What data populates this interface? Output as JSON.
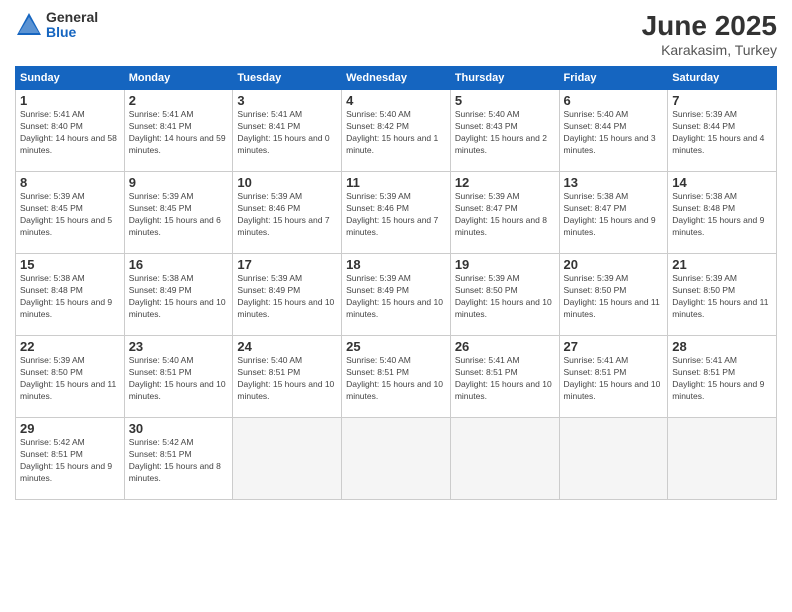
{
  "logo": {
    "general": "General",
    "blue": "Blue"
  },
  "title": "June 2025",
  "location": "Karakasim, Turkey",
  "days_header": [
    "Sunday",
    "Monday",
    "Tuesday",
    "Wednesday",
    "Thursday",
    "Friday",
    "Saturday"
  ],
  "weeks": [
    [
      {
        "day": 1,
        "sunrise": "5:41 AM",
        "sunset": "8:40 PM",
        "daylight": "14 hours and 58 minutes."
      },
      {
        "day": 2,
        "sunrise": "5:41 AM",
        "sunset": "8:41 PM",
        "daylight": "14 hours and 59 minutes."
      },
      {
        "day": 3,
        "sunrise": "5:41 AM",
        "sunset": "8:41 PM",
        "daylight": "15 hours and 0 minutes."
      },
      {
        "day": 4,
        "sunrise": "5:40 AM",
        "sunset": "8:42 PM",
        "daylight": "15 hours and 1 minute."
      },
      {
        "day": 5,
        "sunrise": "5:40 AM",
        "sunset": "8:43 PM",
        "daylight": "15 hours and 2 minutes."
      },
      {
        "day": 6,
        "sunrise": "5:40 AM",
        "sunset": "8:44 PM",
        "daylight": "15 hours and 3 minutes."
      },
      {
        "day": 7,
        "sunrise": "5:39 AM",
        "sunset": "8:44 PM",
        "daylight": "15 hours and 4 minutes."
      }
    ],
    [
      {
        "day": 8,
        "sunrise": "5:39 AM",
        "sunset": "8:45 PM",
        "daylight": "15 hours and 5 minutes."
      },
      {
        "day": 9,
        "sunrise": "5:39 AM",
        "sunset": "8:45 PM",
        "daylight": "15 hours and 6 minutes."
      },
      {
        "day": 10,
        "sunrise": "5:39 AM",
        "sunset": "8:46 PM",
        "daylight": "15 hours and 7 minutes."
      },
      {
        "day": 11,
        "sunrise": "5:39 AM",
        "sunset": "8:46 PM",
        "daylight": "15 hours and 7 minutes."
      },
      {
        "day": 12,
        "sunrise": "5:39 AM",
        "sunset": "8:47 PM",
        "daylight": "15 hours and 8 minutes."
      },
      {
        "day": 13,
        "sunrise": "5:38 AM",
        "sunset": "8:47 PM",
        "daylight": "15 hours and 9 minutes."
      },
      {
        "day": 14,
        "sunrise": "5:38 AM",
        "sunset": "8:48 PM",
        "daylight": "15 hours and 9 minutes."
      }
    ],
    [
      {
        "day": 15,
        "sunrise": "5:38 AM",
        "sunset": "8:48 PM",
        "daylight": "15 hours and 9 minutes."
      },
      {
        "day": 16,
        "sunrise": "5:38 AM",
        "sunset": "8:49 PM",
        "daylight": "15 hours and 10 minutes."
      },
      {
        "day": 17,
        "sunrise": "5:39 AM",
        "sunset": "8:49 PM",
        "daylight": "15 hours and 10 minutes."
      },
      {
        "day": 18,
        "sunrise": "5:39 AM",
        "sunset": "8:49 PM",
        "daylight": "15 hours and 10 minutes."
      },
      {
        "day": 19,
        "sunrise": "5:39 AM",
        "sunset": "8:50 PM",
        "daylight": "15 hours and 10 minutes."
      },
      {
        "day": 20,
        "sunrise": "5:39 AM",
        "sunset": "8:50 PM",
        "daylight": "15 hours and 11 minutes."
      },
      {
        "day": 21,
        "sunrise": "5:39 AM",
        "sunset": "8:50 PM",
        "daylight": "15 hours and 11 minutes."
      }
    ],
    [
      {
        "day": 22,
        "sunrise": "5:39 AM",
        "sunset": "8:50 PM",
        "daylight": "15 hours and 11 minutes."
      },
      {
        "day": 23,
        "sunrise": "5:40 AM",
        "sunset": "8:51 PM",
        "daylight": "15 hours and 10 minutes."
      },
      {
        "day": 24,
        "sunrise": "5:40 AM",
        "sunset": "8:51 PM",
        "daylight": "15 hours and 10 minutes."
      },
      {
        "day": 25,
        "sunrise": "5:40 AM",
        "sunset": "8:51 PM",
        "daylight": "15 hours and 10 minutes."
      },
      {
        "day": 26,
        "sunrise": "5:41 AM",
        "sunset": "8:51 PM",
        "daylight": "15 hours and 10 minutes."
      },
      {
        "day": 27,
        "sunrise": "5:41 AM",
        "sunset": "8:51 PM",
        "daylight": "15 hours and 10 minutes."
      },
      {
        "day": 28,
        "sunrise": "5:41 AM",
        "sunset": "8:51 PM",
        "daylight": "15 hours and 9 minutes."
      }
    ],
    [
      {
        "day": 29,
        "sunrise": "5:42 AM",
        "sunset": "8:51 PM",
        "daylight": "15 hours and 9 minutes."
      },
      {
        "day": 30,
        "sunrise": "5:42 AM",
        "sunset": "8:51 PM",
        "daylight": "15 hours and 8 minutes."
      },
      null,
      null,
      null,
      null,
      null
    ]
  ]
}
